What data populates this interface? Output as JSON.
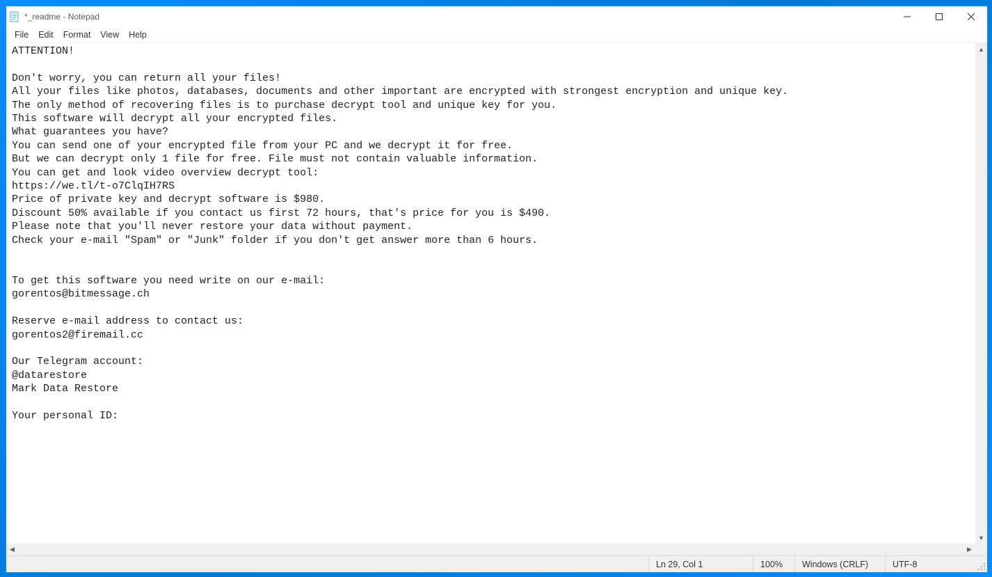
{
  "titlebar": {
    "title": "*_readme - Notepad"
  },
  "menubar": {
    "items": [
      "File",
      "Edit",
      "Format",
      "View",
      "Help"
    ]
  },
  "document": {
    "text": "ATTENTION!\n\nDon't worry, you can return all your files!\nAll your files like photos, databases, documents and other important are encrypted with strongest encryption and unique key.\nThe only method of recovering files is to purchase decrypt tool and unique key for you.\nThis software will decrypt all your encrypted files.\nWhat guarantees you have?\nYou can send one of your encrypted file from your PC and we decrypt it for free.\nBut we can decrypt only 1 file for free. File must not contain valuable information.\nYou can get and look video overview decrypt tool:\nhttps://we.tl/t-o7ClqIH7RS\nPrice of private key and decrypt software is $980.\nDiscount 50% available if you contact us first 72 hours, that's price for you is $490.\nPlease note that you'll never restore your data without payment.\nCheck your e-mail \"Spam\" or \"Junk\" folder if you don't get answer more than 6 hours.\n\n\nTo get this software you need write on our e-mail:\ngorentos@bitmessage.ch\n\nReserve e-mail address to contact us:\ngorentos2@firemail.cc\n\nOur Telegram account:\n@datarestore\nMark Data Restore\n\nYour personal ID:"
  },
  "statusbar": {
    "position": "Ln 29, Col 1",
    "zoom": "100%",
    "line_ending": "Windows (CRLF)",
    "encoding": "UTF-8"
  }
}
